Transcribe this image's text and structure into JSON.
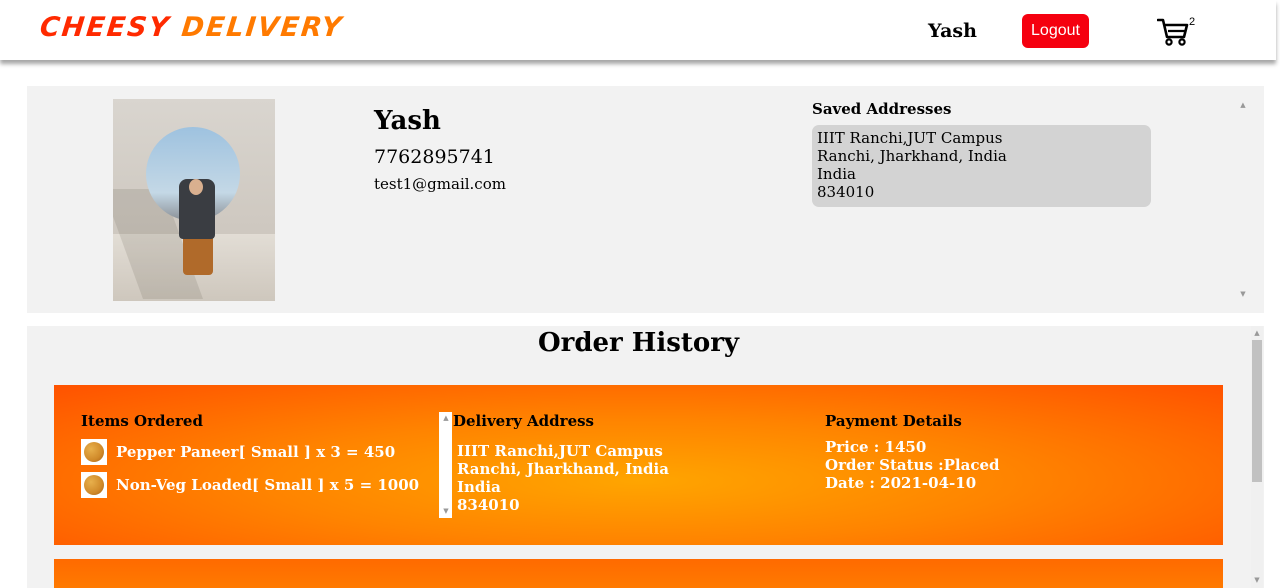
{
  "header": {
    "logo_part1": "CHEESY",
    "logo_part2": "DELIVERY",
    "username": "Yash",
    "logout_label": "Logout",
    "cart_count": "2"
  },
  "profile": {
    "name": "Yash",
    "phone": "7762895741",
    "email": "test1@gmail.com",
    "saved_addresses_title": "Saved Addresses",
    "address": {
      "line1": "IIIT Ranchi,JUT Campus",
      "line2": "Ranchi, Jharkhand, India",
      "line3": "India",
      "line4": "834010"
    }
  },
  "history": {
    "title": "Order History",
    "orders": [
      {
        "items_title": "Items Ordered",
        "items": [
          {
            "label": "Pepper Paneer[ Small ] x 3 = 450"
          },
          {
            "label": "Non-Veg Loaded[ Small ] x 5 = 1000"
          }
        ],
        "delivery_title": "Delivery Address",
        "delivery": {
          "line1": "IIIT Ranchi,JUT Campus",
          "line2": "Ranchi, Jharkhand, India",
          "line3": "India",
          "line4": "834010"
        },
        "payment_title": "Payment Details",
        "price": "Price : 1450",
        "status": "Order Status :Placed",
        "date": "Date : 2021-04-10"
      }
    ]
  },
  "colors": {
    "brand_red": "#ff2a00",
    "brand_orange": "#ff7a00",
    "logout_bg": "#f5000f",
    "order_card": "#ff8400"
  },
  "icons": {
    "cart": "shopping-cart-icon",
    "item": "pizza-icon"
  }
}
